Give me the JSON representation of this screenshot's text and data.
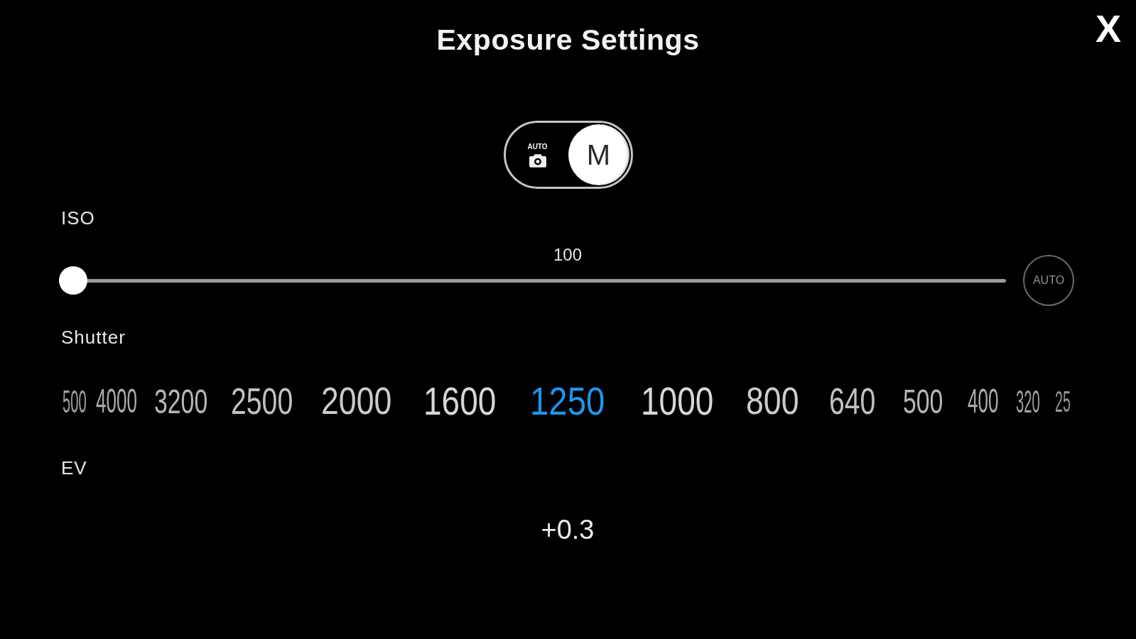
{
  "title": "Exposure Settings",
  "close_button": {
    "label": "X"
  },
  "mode_toggle": {
    "options": [
      {
        "kind": "auto",
        "label": "AUTO",
        "selected": false
      },
      {
        "kind": "manual",
        "label": "M",
        "selected": true
      }
    ]
  },
  "iso": {
    "label": "ISO",
    "value": "100",
    "level": 0,
    "auto_button": {
      "label": "AUTO",
      "selected": false
    }
  },
  "shutter": {
    "label": "Shutter",
    "values": [
      {
        "label": "500",
        "selected": false
      },
      {
        "label": "4000",
        "selected": false
      },
      {
        "label": "3200",
        "selected": false
      },
      {
        "label": "2500",
        "selected": false
      },
      {
        "label": "2000",
        "selected": false
      },
      {
        "label": "1600",
        "selected": false
      },
      {
        "label": "1250",
        "selected": true
      },
      {
        "label": "1000",
        "selected": false
      },
      {
        "label": "800",
        "selected": false
      },
      {
        "label": "640",
        "selected": false
      },
      {
        "label": "500",
        "selected": false
      },
      {
        "label": "400",
        "selected": false
      },
      {
        "label": "320",
        "selected": false
      },
      {
        "label": "25",
        "selected": false
      }
    ]
  },
  "ev": {
    "label": "EV",
    "value": "+0.3"
  }
}
